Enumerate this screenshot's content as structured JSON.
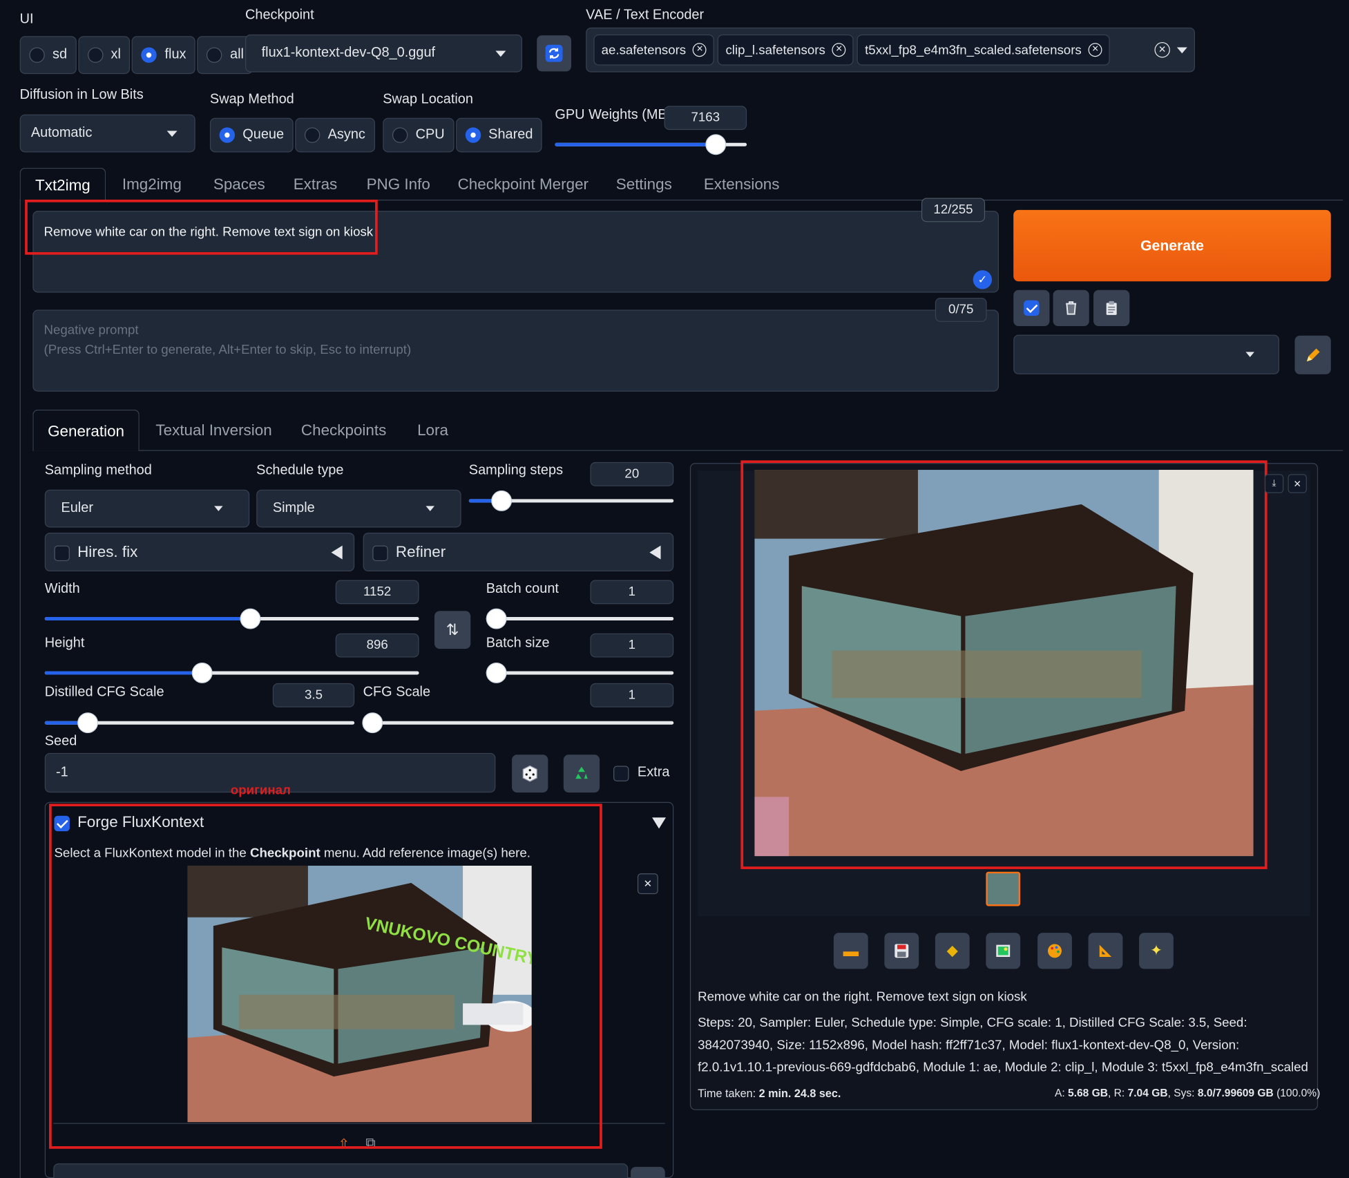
{
  "top": {
    "ui_label": "UI",
    "ui_options": [
      "sd",
      "xl",
      "flux",
      "all"
    ],
    "ui_selected": "flux",
    "checkpoint_label": "Checkpoint",
    "checkpoint_value": "flux1-kontext-dev-Q8_0.gguf",
    "vae_label": "VAE / Text Encoder",
    "vae_chips": [
      "ae.safetensors",
      "clip_l.safetensors",
      "t5xxl_fp8_e4m3fn_scaled.safetensors"
    ],
    "diffusion_label": "Diffusion in Low Bits",
    "diffusion_value": "Automatic",
    "swap_method_label": "Swap Method",
    "swap_method_options": [
      "Queue",
      "Async"
    ],
    "swap_method_selected": "Queue",
    "swap_location_label": "Swap Location",
    "swap_location_options": [
      "CPU",
      "Shared"
    ],
    "swap_location_selected": "Shared",
    "gpu_weights_label": "GPU Weights (MB)",
    "gpu_weights_value": "7163",
    "gpu_weights_fraction": 0.84
  },
  "tabs": [
    "Txt2img",
    "Img2img",
    "Spaces",
    "Extras",
    "PNG Info",
    "Checkpoint Merger",
    "Settings",
    "Extensions"
  ],
  "prompt": {
    "text": "Remove white car on the right. Remove text sign on kiosk",
    "counter": "12/255",
    "neg_counter": "0/75",
    "neg_placeholder_1": "Negative prompt",
    "neg_placeholder_2": "(Press Ctrl+Enter to generate, Alt+Enter to skip, Esc to interrupt)"
  },
  "generate_label": "Generate",
  "subtabs": [
    "Generation",
    "Textual Inversion",
    "Checkpoints",
    "Lora"
  ],
  "gen": {
    "sampling_method_label": "Sampling method",
    "sampling_method": "Euler",
    "schedule_type_label": "Schedule type",
    "schedule_type": "Simple",
    "sampling_steps_label": "Sampling steps",
    "sampling_steps": "20",
    "sampling_steps_fraction": 0.16,
    "hires_label": "Hires. fix",
    "refiner_label": "Refiner",
    "width_label": "Width",
    "width": "1152",
    "width_fraction": 0.55,
    "height_label": "Height",
    "height": "896",
    "height_fraction": 0.42,
    "batch_count_label": "Batch count",
    "batch_count": "1",
    "batch_count_fraction": 0.0,
    "batch_size_label": "Batch size",
    "batch_size": "1",
    "batch_size_fraction": 0.0,
    "dcfg_label": "Distilled CFG Scale",
    "dcfg": "3.5",
    "dcfg_fraction": 0.14,
    "cfg_label": "CFG Scale",
    "cfg": "1",
    "cfg_fraction": 0.03,
    "seed_label": "Seed",
    "seed": "-1",
    "extra_label": "Extra"
  },
  "annotation_original": "оригинал",
  "flux": {
    "title": "Forge FluxKontext",
    "desc_pre": "Select a FluxKontext model in the ",
    "desc_bold": "Checkpoint",
    "desc_post": " menu. Add reference image(s) here.",
    "sign_text": "VNUKOVO COUNTRY CLUB"
  },
  "output": {
    "prompt": "Remove white car on the right. Remove text sign on kiosk",
    "info": "Steps: 20, Sampler: Euler, Schedule type: Simple, CFG scale: 1, Distilled CFG Scale: 3.5, Seed: 3842073940, Size: 1152x896, Model hash: ff2ff71c37, Model: flux1-kontext-dev-Q8_0, Version: f2.0.1v1.10.1-previous-669-gdfdcbab6, Module 1: ae, Module 2: clip_l, Module 3: t5xxl_fp8_e4m3fn_scaled",
    "time_label": "Time taken: ",
    "time_value": "2 min. 24.8 sec.",
    "mem_a_label": "A: ",
    "mem_a": "5.68 GB",
    "mem_r_label": ", R: ",
    "mem_r": "7.04 GB",
    "mem_s_label": ", Sys: ",
    "mem_s": "8.0/7.99609 GB",
    "mem_pct": " (100.0%)"
  },
  "colors": {
    "accent": "#2563eb",
    "generate": "#f97316",
    "annotation": "#e11d1d"
  }
}
